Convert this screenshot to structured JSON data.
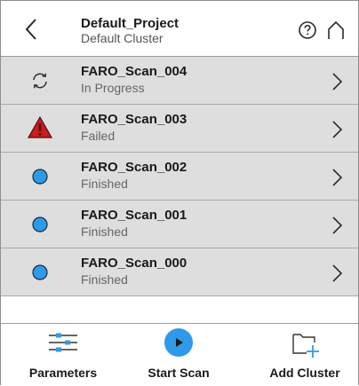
{
  "header": {
    "title": "Default_Project",
    "subtitle": "Default Cluster",
    "icons": {
      "back": "chevron-left-icon",
      "help": "question-circle-icon",
      "home": "home-caret-icon"
    }
  },
  "scans": [
    {
      "name": "FARO_Scan_004",
      "status": "In Progress",
      "icon": "sync-icon"
    },
    {
      "name": "FARO_Scan_003",
      "status": "Failed",
      "icon": "warning-triangle-icon"
    },
    {
      "name": "FARO_Scan_002",
      "status": "Finished",
      "icon": "finished-dot-icon"
    },
    {
      "name": "FARO_Scan_001",
      "status": "Finished",
      "icon": "finished-dot-icon"
    },
    {
      "name": "FARO_Scan_000",
      "status": "Finished",
      "icon": "finished-dot-icon"
    }
  ],
  "footer": {
    "parameters_label": "Parameters",
    "start_scan_label": "Start Scan",
    "add_cluster_label": "Add Cluster"
  },
  "colors": {
    "accent_blue": "#2f9ae9",
    "failed_red": "#c61d1d",
    "row_background": "#dedede"
  }
}
